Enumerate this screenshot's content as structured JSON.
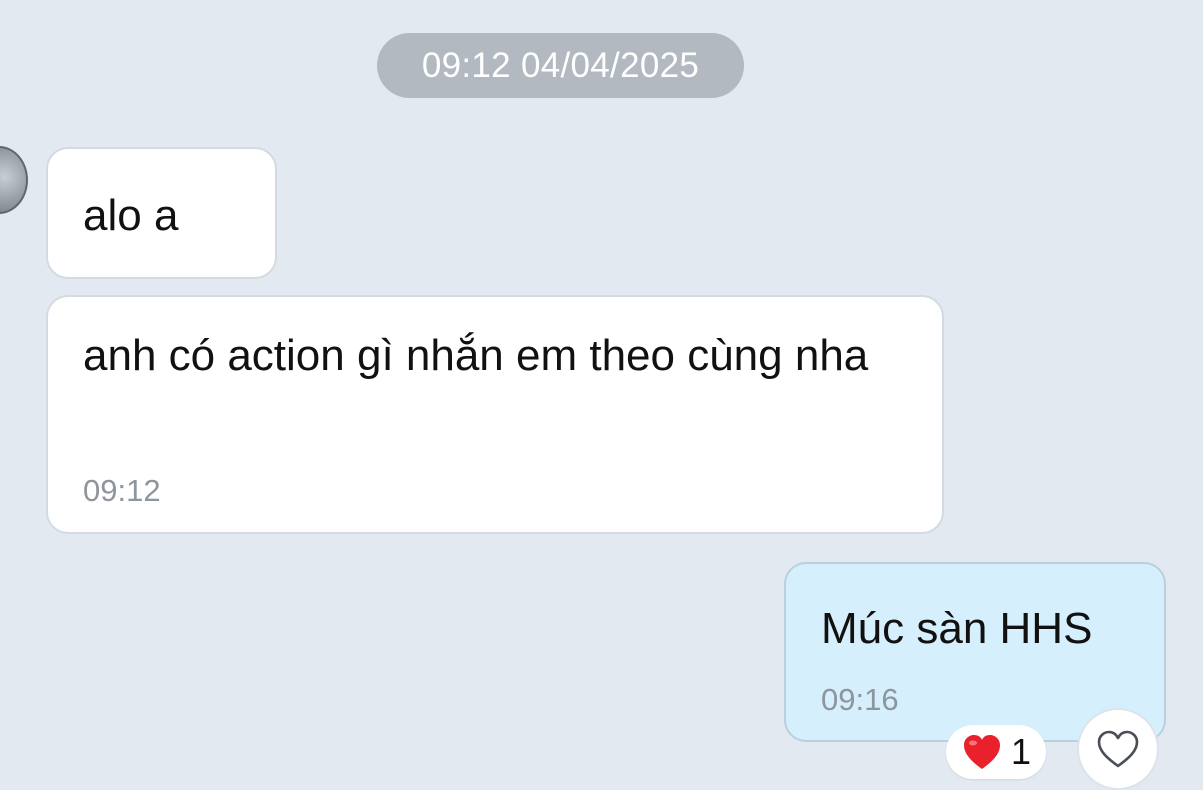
{
  "chat": {
    "date_separator": "09:12 04/04/2025",
    "messages": [
      {
        "direction": "incoming",
        "text": "alo a",
        "time": ""
      },
      {
        "direction": "incoming",
        "text": "anh có action gì nhắn em theo cùng nha",
        "time": "09:12"
      },
      {
        "direction": "outgoing",
        "text": "Múc sàn HHS",
        "time": "09:16"
      }
    ],
    "reaction": {
      "emoji_icon": "heart-emoji-icon",
      "count": "1"
    },
    "react_button_icon": "heart-outline-icon"
  },
  "colors": {
    "background": "#e2e9f1",
    "incoming_bubble": "#ffffff",
    "outgoing_bubble": "#d5effc",
    "date_pill": "#b3b9c1",
    "timestamp": "#8e959c",
    "reaction_heart": "#e8212d"
  }
}
